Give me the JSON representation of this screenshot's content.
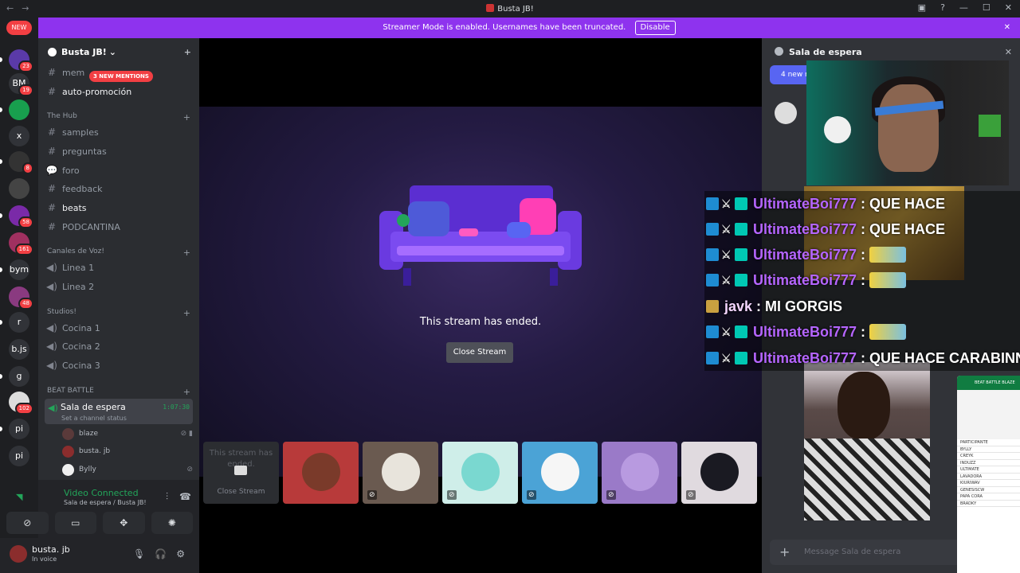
{
  "titlebar": {
    "title": "Busta JB!",
    "back": "←",
    "forward": "→",
    "inbox": "▣",
    "help": "?",
    "minimize": "—",
    "maximize": "☐",
    "close": "✕"
  },
  "banner": {
    "text": "Streamer Mode is enabled. Usernames have been truncated.",
    "button": "Disable",
    "close": "✕"
  },
  "guilds": [
    {
      "label": "NEW"
    },
    {
      "badge": "23"
    },
    {
      "label": "BM",
      "badge": "19"
    },
    {
      "label": "",
      "badge": ""
    },
    {
      "label": "x"
    },
    {
      "badge": "8"
    },
    {
      "label": ""
    },
    {
      "badge": "58"
    },
    {
      "badge": "161"
    },
    {
      "label": "bym"
    },
    {
      "badge": "48"
    },
    {
      "label": "r"
    },
    {
      "label": "b.js"
    },
    {
      "label": "g"
    },
    {
      "badge": "102"
    },
    {
      "label": "pi"
    },
    {
      "label": "pi"
    }
  ],
  "server": {
    "name": "Busta JB!",
    "chevron": "⌄",
    "add_icon": "+"
  },
  "mentions_pill": "3 NEW MENTIONS",
  "channels": {
    "top": [
      {
        "name": "mem",
        "icon": "#"
      },
      {
        "name": "auto-promoción",
        "icon": "#"
      }
    ],
    "hub_category": "The Hub",
    "hub": [
      {
        "name": "samples",
        "icon": "#"
      },
      {
        "name": "preguntas",
        "icon": "#"
      },
      {
        "name": "foro",
        "icon": "💬"
      },
      {
        "name": "feedback",
        "icon": "#"
      },
      {
        "name": "beats",
        "icon": "#"
      },
      {
        "name": "PODCANTINA",
        "icon": "#"
      }
    ],
    "voz_category": "Canales de Voz!",
    "voz": [
      {
        "name": "Linea 1"
      },
      {
        "name": "Linea 2"
      }
    ],
    "studios_category": "Studios!",
    "studios": [
      {
        "name": "Cocina 1"
      },
      {
        "name": "Cocina 2"
      },
      {
        "name": "Cocina 3"
      }
    ],
    "battle_category": "BEAT BATTLE",
    "active": {
      "name": "Sala de espera",
      "status": "Set a channel status",
      "time": "1:07:30"
    },
    "users": [
      {
        "name": "blaze",
        "color": "#5a3a3a"
      },
      {
        "name": "busta. jb",
        "color": "#8b2d2d"
      },
      {
        "name": "Bylly",
        "color": "#f0f0f0"
      }
    ]
  },
  "voice": {
    "title": "Video Connected",
    "sub": "Sala de espera / Busta JB!"
  },
  "me": {
    "name": "busta. jb",
    "status": "In voice"
  },
  "stage": {
    "ended": "This stream has ended.",
    "close": "Close Stream"
  },
  "tiles": {
    "first_text": "This stream has ended.",
    "first_close": "Close Stream",
    "others": [
      {
        "name": "avatar-red",
        "color": "#b83a3a"
      },
      {
        "name": "avatar-hat",
        "color": "#6a5a50"
      },
      {
        "name": "avatar-anime",
        "color": "#cfeee9"
      },
      {
        "name": "avatar-pocoyo",
        "color": "#4ba3d6"
      },
      {
        "name": "avatar-greyk",
        "color": "#9a7ac8"
      },
      {
        "name": "avatar-dark",
        "color": "#e0dadf"
      }
    ]
  },
  "chat": {
    "header": "Sala de espera",
    "new_messages": "4 new m",
    "placeholder": "Message Sala de espera",
    "close": "✕",
    "plus": "+"
  },
  "overlay_lines": [
    {
      "name": "UltimateBoi777",
      "text": "QUE HACE",
      "emote": false
    },
    {
      "name": "UltimateBoi777",
      "text": "QUE HACE",
      "emote": false
    },
    {
      "name": "UltimateBoi777",
      "text": "",
      "emote": true
    },
    {
      "name": "UltimateBoi777",
      "text": "",
      "emote": true
    },
    {
      "name": "javk",
      "text": "MI GORGIS",
      "emote": false
    },
    {
      "name": "UltimateBoi777",
      "text": "",
      "emote": true
    },
    {
      "name": "UltimateBoi777",
      "text": "QUE HACE CARABINNE",
      "emote": false
    }
  ],
  "sheet": {
    "title": "BEAT BATTLE BLAZE",
    "rows": [
      "PARTICIPANTE",
      "BYLLY",
      "CREYK",
      "INDUZZ",
      "ULTIMATE",
      "LAVADORA",
      "KIURIWAV",
      "GENESISCW",
      "PAPA CORA",
      "BRADKY"
    ]
  },
  "colors": {
    "accent": "#5865f2",
    "banner": "#8e33ee",
    "online": "#23a55a",
    "danger": "#f23f43"
  }
}
